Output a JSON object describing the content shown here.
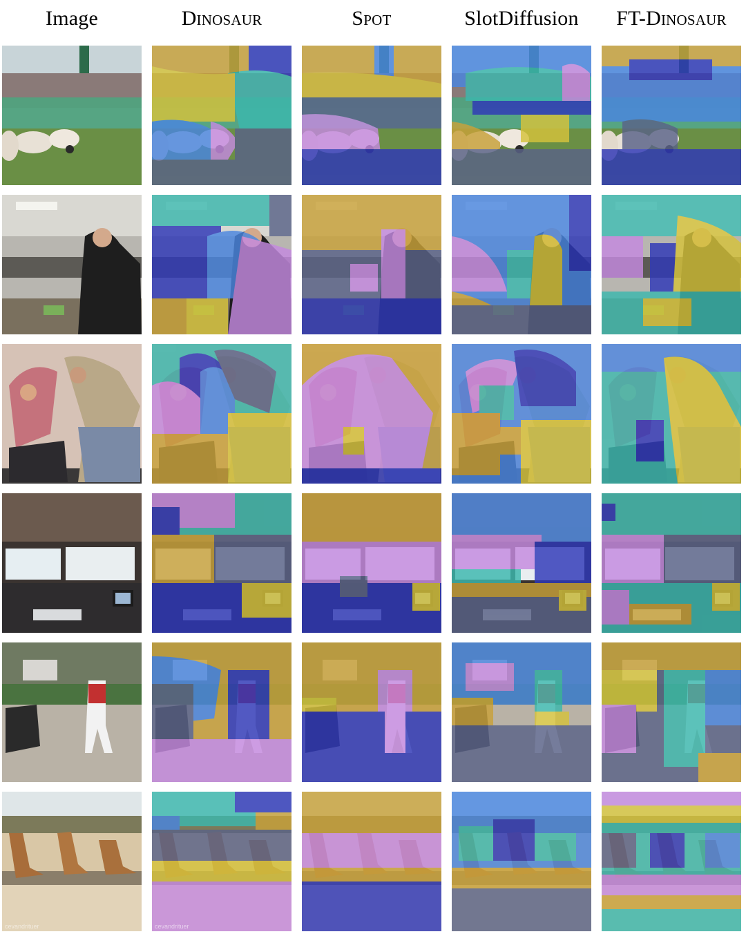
{
  "columns": [
    {
      "key": "image",
      "label": "Image",
      "smallcaps": false
    },
    {
      "key": "dinosaur",
      "label": "Dinosaur",
      "smallcaps": true
    },
    {
      "key": "spot",
      "label": "Spot",
      "smallcaps": true
    },
    {
      "key": "slotdiffusion",
      "label": "SlotDiffusion",
      "smallcaps": false
    },
    {
      "key": "ft_dinosaur",
      "label": "FT-Dinosaur",
      "smallcaps": true
    }
  ],
  "rows": [
    {
      "scene": "sheep-herding"
    },
    {
      "scene": "kitchen-chef"
    },
    {
      "scene": "couple-stretching"
    },
    {
      "scene": "desk-monitors"
    },
    {
      "scene": "baseball-batter"
    },
    {
      "scene": "giraffes-drinking"
    }
  ],
  "colors": {
    "mustard": "#c9a23a",
    "navy": "#2f38b8",
    "blue": "#4a86e0",
    "teal": "#3cb8ae",
    "slate": "#5a6388",
    "violet": "#c58ae0",
    "yellow": "#d6c33c"
  },
  "watermark": "cevandrituer"
}
